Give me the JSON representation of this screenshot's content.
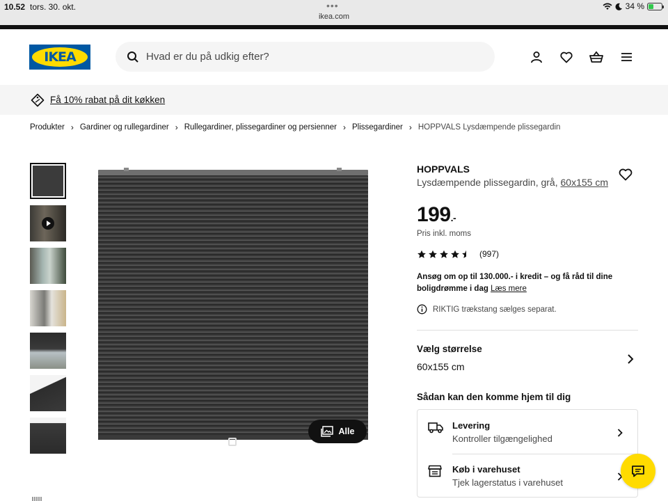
{
  "status_bar": {
    "time": "10.52",
    "date": "tors. 30. okt.",
    "url": "ikea.com",
    "battery": "34 %",
    "battery_level_percent": 34
  },
  "header": {
    "logo_text": "IKEA",
    "search_placeholder": "Hvad er du på udkig efter?",
    "icons": [
      "search-icon",
      "user-icon",
      "heart-icon",
      "basket-icon",
      "menu-icon"
    ]
  },
  "promo": {
    "text": "Få 10% rabat på dit køkken",
    "icon": "tag-icon"
  },
  "breadcrumb": [
    "Produkter",
    "Gardiner og rullegardiner",
    "Rullegardiner, plissegardiner og persienner",
    "Plissegardiner",
    "HOPPVALS Lysdæmpende plissegardin"
  ],
  "gallery": {
    "all_label": "Alle"
  },
  "product": {
    "name": "HOPPVALS",
    "description": "Lysdæmpende plissegardin, grå,",
    "size_link": "60x155 cm",
    "price": "199",
    "price_suffix": ".-",
    "vat_text": "Pris inkl. moms",
    "rating_value": 4.5,
    "rating_max": 5,
    "review_count": "(997)",
    "credit_text": "Ansøg om op til 130.000.- i kredit – og få råd til dine boligdrømme i dag",
    "credit_link": "Læs mere",
    "note": "RIKTIG trækstang sælges separat."
  },
  "size": {
    "title": "Vælg størrelse",
    "value": "60x155 cm"
  },
  "delivery": {
    "title": "Sådan kan den komme hjem til dig",
    "options": [
      {
        "title": "Levering",
        "subtitle": "Kontroller tilgængelighed",
        "icon": "truck-icon"
      },
      {
        "title": "Køb i varehuset",
        "subtitle": "Tjek lagerstatus i varehuset",
        "icon": "store-icon"
      }
    ]
  },
  "colors": {
    "ikea_blue": "#0058a3",
    "ikea_yellow": "#ffdb00",
    "light_gray": "#f5f5f5"
  }
}
